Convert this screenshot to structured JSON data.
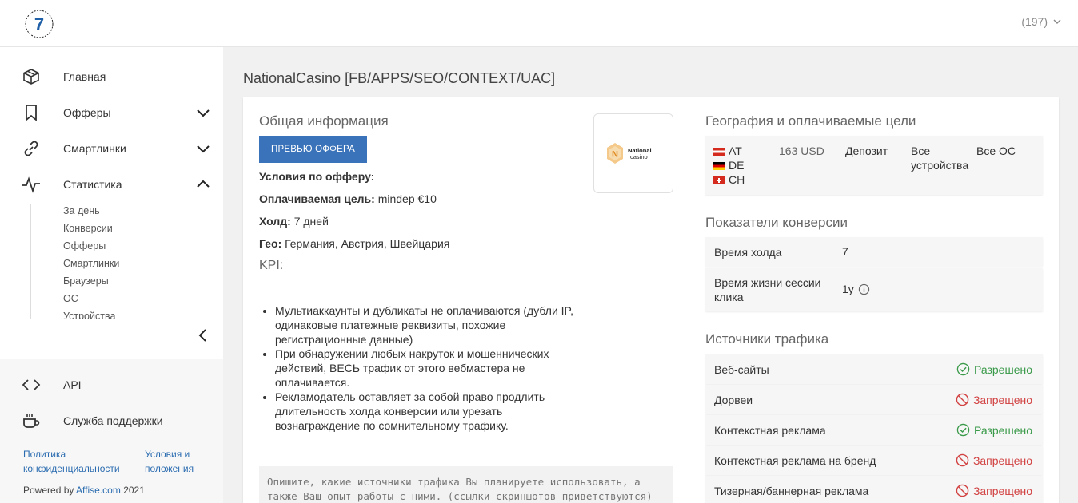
{
  "header": {
    "count": "(197)"
  },
  "sidebar": {
    "nav": [
      {
        "label": "Главная"
      },
      {
        "label": "Офферы"
      },
      {
        "label": "Смартлинки"
      },
      {
        "label": "Статистика"
      }
    ],
    "sub": [
      "За день",
      "Конверсии",
      "Офферы",
      "Смартлинки",
      "Браузеры",
      "ОС",
      "Устройства"
    ],
    "bottom": [
      {
        "label": "API"
      },
      {
        "label": "Служба поддержки"
      }
    ],
    "privacy": "Политика конфиденциальности",
    "terms": "Условия и положения",
    "powered_prefix": "Powered by",
    "powered_link": "Affise.com",
    "year": "2021"
  },
  "page": {
    "title": "NationalCasino [FB/APPS/SEO/CONTEXT/UAC]"
  },
  "general": {
    "title": "Общая информация",
    "preview_btn": "ПРЕВЬЮ ОФФЕРА",
    "conditions": "Условия по офферу:",
    "goal_label": "Оплачиваемая цель:",
    "goal_value": "mindep €10",
    "hold_label": "Холд:",
    "hold_value": "7 дней",
    "geo_label": "Гео:",
    "geo_value": "Германия, Австрия, Швейцария",
    "kpi_title": "KPI:",
    "kpi": [
      "Мультиаккаунты и дубликаты не оплачиваются (дубли IP, одинаковые платежные реквизиты, похожие регистрационные данные)",
      "При обнаружении любых накруток и мошеннических действий, ВЕСЬ трафик от этого вебмастера не оплачивается.",
      "Рекламодатель оставляет за собой право продлить длительность холда конверсии или урезать вознаграждение по сомнительному трафику."
    ],
    "brand_logo_text": "National casino",
    "textarea_placeholder": "Опишите, какие источники трафика Вы планируете использовать, а также Ваш опыт работы с ними. (ссылки скриншотов приветствуются)"
  },
  "geo": {
    "title": "География и оплачиваемые цели",
    "countries": [
      "AT",
      "DE",
      "CH"
    ],
    "payout": "163 USD",
    "goal": "Депозит",
    "devices": "Все устройства",
    "os": "Все ОС"
  },
  "conversion": {
    "title": "Показатели конверсии",
    "rows": [
      {
        "label": "Время холда",
        "value": "7"
      },
      {
        "label": "Время жизни сессии клика",
        "value": "1y"
      }
    ]
  },
  "traffic": {
    "title": "Источники трафика",
    "rows": [
      {
        "label": "Веб-сайты",
        "status": "Разрешено"
      },
      {
        "label": "Дорвеи",
        "status": "Запрещено"
      },
      {
        "label": "Контекстная реклама",
        "status": "Разрешено"
      },
      {
        "label": "Контекстная реклама на бренд",
        "status": "Запрещено"
      },
      {
        "label": "Тизерная/баннерная реклама",
        "status": "Запрещено"
      }
    ]
  },
  "colors": {
    "accent": "#3a73b9",
    "allowed": "#3a9a4a",
    "denied": "#d24242"
  }
}
